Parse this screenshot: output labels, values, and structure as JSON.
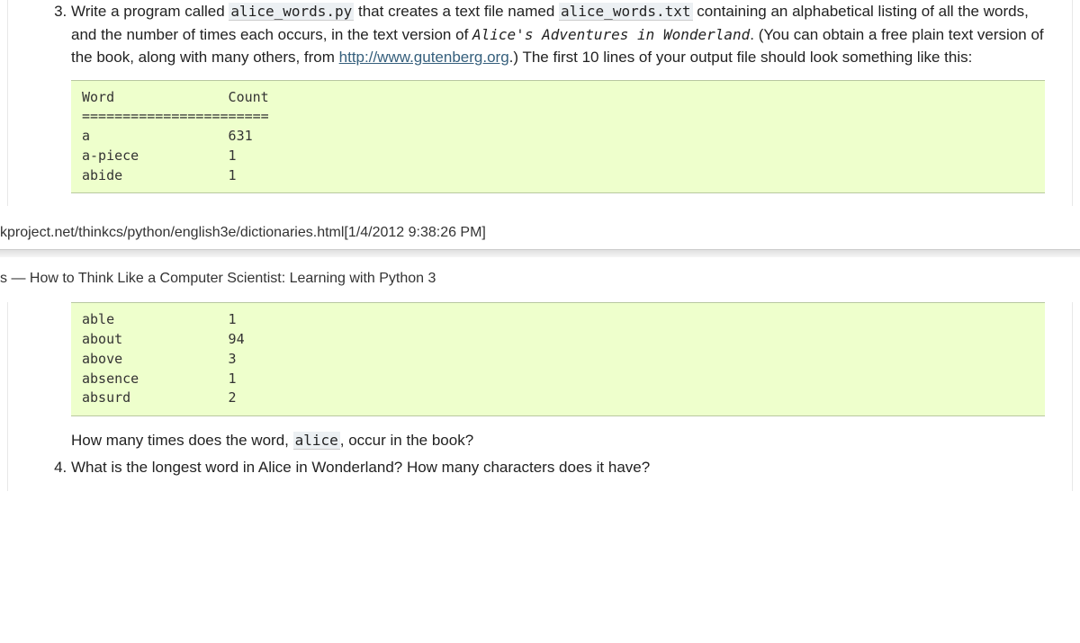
{
  "item3": {
    "text_part1": "Write a program called ",
    "code1": "alice_words.py",
    "text_part2": " that creates a text file named ",
    "code2": "alice_words.txt",
    "text_part3": " containing an alphabetical listing of all the words, and the number of times each occurs, in the text version of ",
    "italic_code": "Alice's Adventures in Wonderland",
    "text_part4": ". (You can obtain a free plain text version of the book, along with many others, from ",
    "link_text": "http://www.gutenberg.org",
    "text_part5": ".) The first 10 lines of your output file should look something like this:",
    "pre1": "Word              Count\n=======================\na                 631\na-piece           1\nabide             1",
    "pre2": "able              1\nabout             94\nabove             3\nabsence           1\nabsurd            2",
    "question_part1": "How many times does the word, ",
    "question_code": "alice",
    "question_part2": ", occur in the book?"
  },
  "footer_url": "kproject.net/thinkcs/python/english3e/dictionaries.html[1/4/2012 9:38:26 PM]",
  "header_prefix": "s — ",
  "header_title": "How to Think Like a Computer Scientist: Learning with Python 3",
  "item4": {
    "text": "What is the longest word in Alice in Wonderland? How many characters does it have?"
  }
}
